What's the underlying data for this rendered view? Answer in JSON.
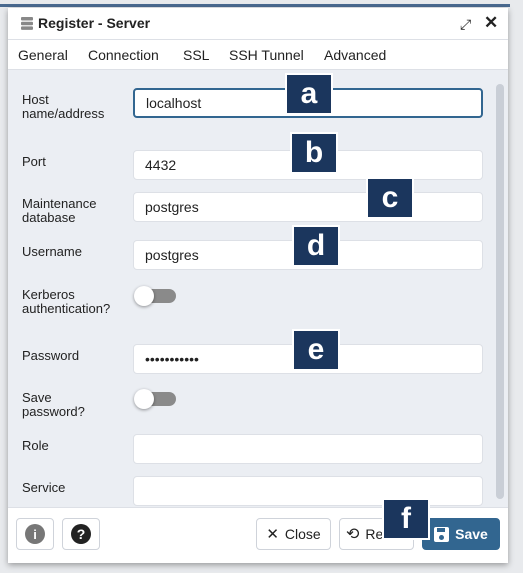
{
  "dialog": {
    "title": "Register - Server",
    "icon": "server-icon"
  },
  "tabs": [
    {
      "label": "General"
    },
    {
      "label": "Connection",
      "active": true
    },
    {
      "label": "SSL"
    },
    {
      "label": "SSH Tunnel"
    },
    {
      "label": "Advanced"
    }
  ],
  "form": {
    "host": {
      "label": "Host name/address",
      "value": "localhost"
    },
    "port": {
      "label": "Port",
      "value": "4432"
    },
    "maintenance_db": {
      "label": "Maintenance database",
      "value": "postgres"
    },
    "username": {
      "label": "Username",
      "value": "postgres"
    },
    "kerberos": {
      "label": "Kerberos authentication?",
      "on": false
    },
    "password": {
      "label": "Password",
      "value": "•••••••••••"
    },
    "save_password": {
      "label": "Save password?",
      "on": false
    },
    "role": {
      "label": "Role",
      "value": ""
    },
    "service": {
      "label": "Service",
      "value": ""
    }
  },
  "footer": {
    "close": "Close",
    "reset": "Reset",
    "save": "Save"
  },
  "badges": [
    "a",
    "b",
    "c",
    "d",
    "e",
    "f"
  ],
  "colors": {
    "accent": "#326690",
    "badge": "#1b365d"
  }
}
